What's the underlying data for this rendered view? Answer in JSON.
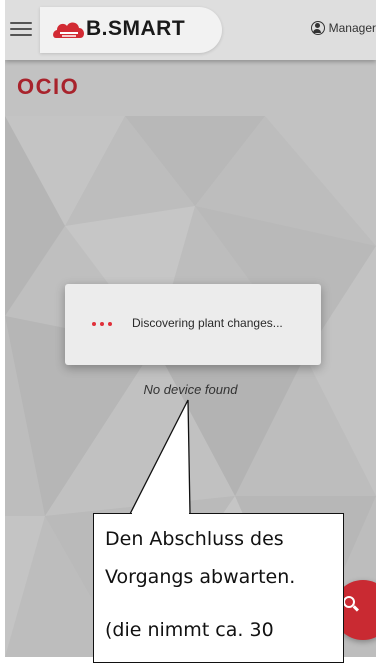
{
  "header": {
    "menu_icon": "hamburger-icon",
    "logo_icon": "cloud-logo-icon",
    "logo_text": "B.SMART",
    "user_icon": "account-circle-icon",
    "user_label": "Manager"
  },
  "page": {
    "title": "OCIO"
  },
  "dialog": {
    "spinner_icon": "loading-dots-icon",
    "message": "Discovering plant changes..."
  },
  "content": {
    "empty_message": "No device found"
  },
  "fab": {
    "icon": "search-icon"
  },
  "callout": {
    "line1": "Den Abschluss des",
    "line2": "Vorgangs abwarten.",
    "line3": "(die nimmt ca. 30"
  },
  "colors": {
    "brand_red": "#a8232c",
    "fab_red": "#c92a32",
    "dot_red": "#e0303a"
  }
}
